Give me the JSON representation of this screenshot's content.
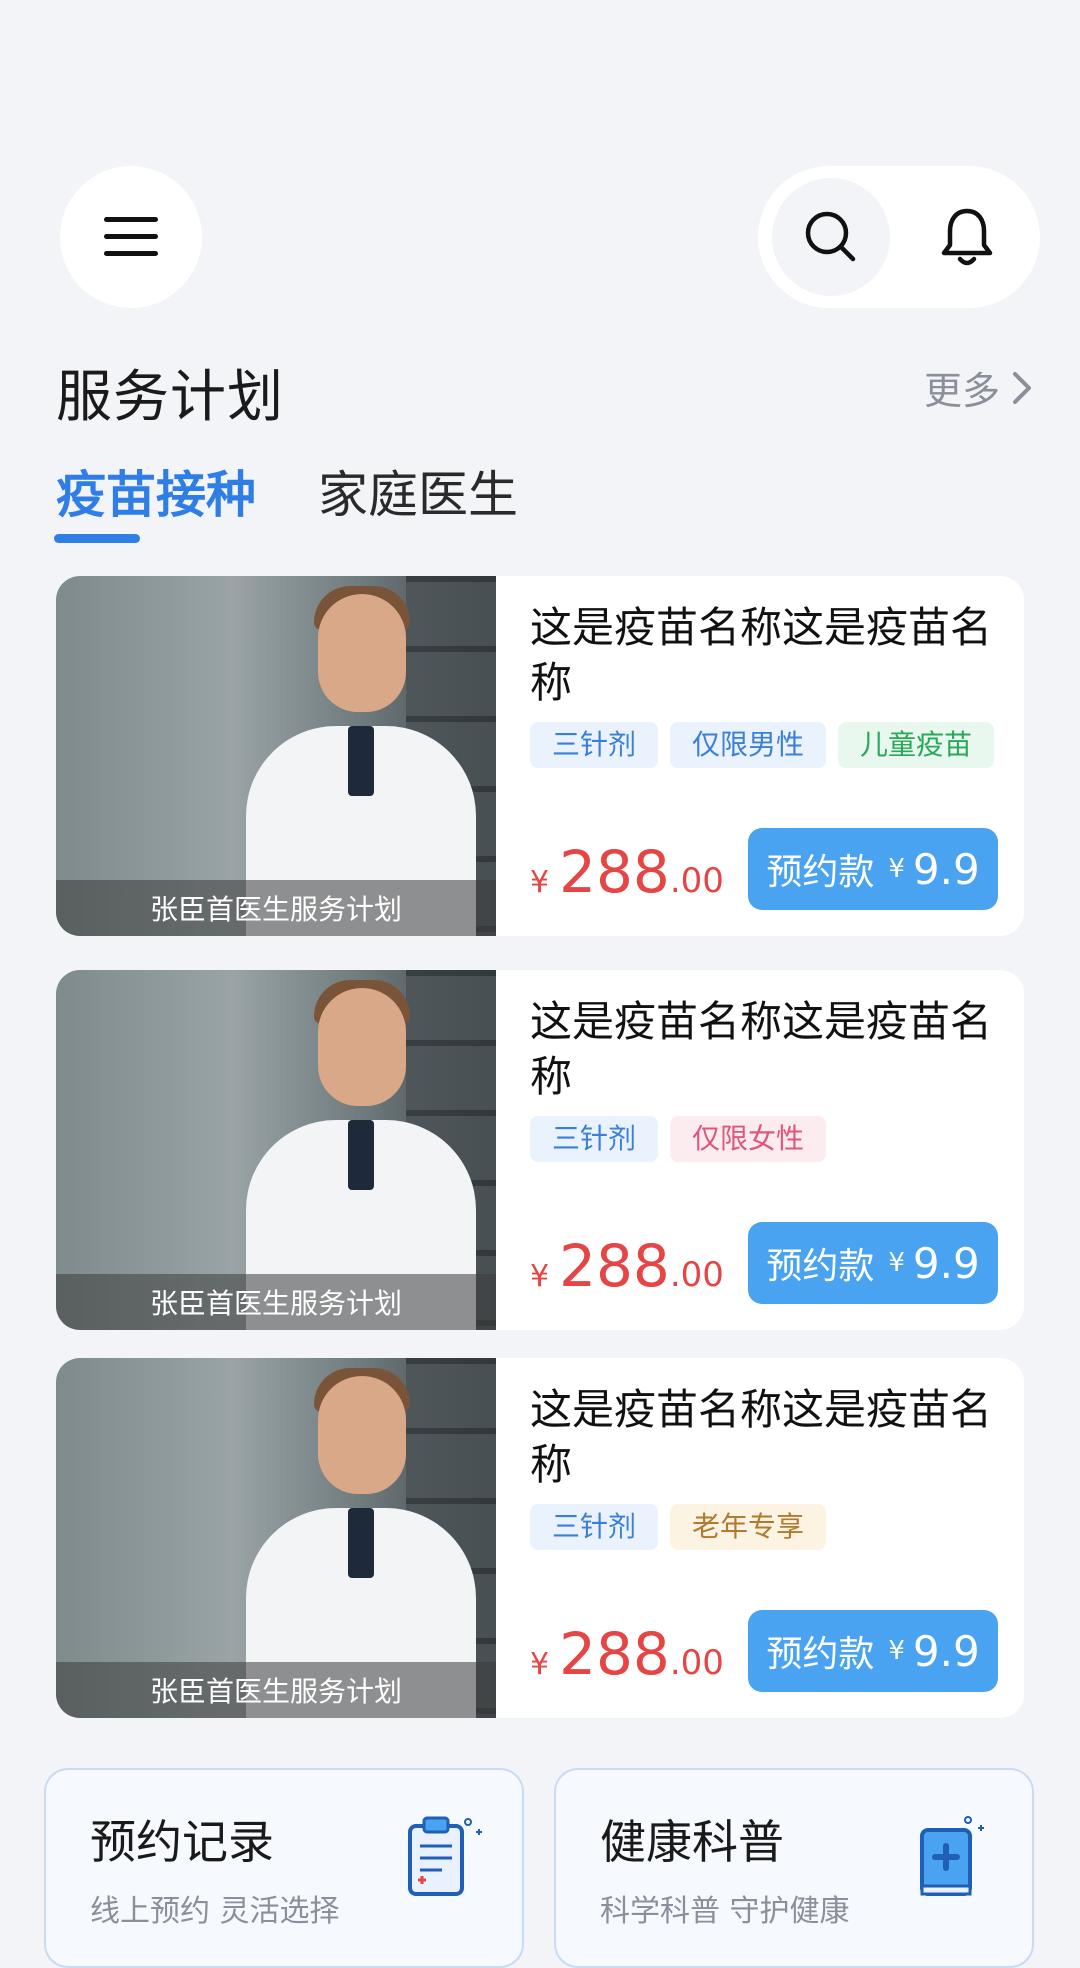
{
  "header": {
    "menu_icon": "menu-icon",
    "search_icon": "search-icon",
    "bell_icon": "bell-icon"
  },
  "section": {
    "title": "服务计划",
    "more": "更多"
  },
  "tabs": [
    {
      "label": "疫苗接种",
      "active": true
    },
    {
      "label": "家庭医生",
      "active": false
    }
  ],
  "cards": [
    {
      "image_caption": "张臣首医生服务计划",
      "name": "这是疫苗名称这是疫苗名称",
      "tags": [
        {
          "label": "三针剂",
          "color": "#3b7fd9"
        },
        {
          "label": "仅限男性",
          "color": "#3b7fd9"
        },
        {
          "label": "儿童疫苗",
          "color": "#2aa75a"
        }
      ],
      "price": {
        "currency": "¥",
        "integer": "288",
        "decimal": ".00"
      },
      "button": {
        "label": "预约款",
        "currency": "¥",
        "amount": "9.9"
      }
    },
    {
      "image_caption": "张臣首医生服务计划",
      "name": "这是疫苗名称这是疫苗名称",
      "tags": [
        {
          "label": "三针剂",
          "color": "#3b7fd9"
        },
        {
          "label": "仅限女性",
          "color": "#e0567a"
        }
      ],
      "price": {
        "currency": "¥",
        "integer": "288",
        "decimal": ".00"
      },
      "button": {
        "label": "预约款",
        "currency": "¥",
        "amount": "9.9"
      }
    },
    {
      "image_caption": "张臣首医生服务计划",
      "name": "这是疫苗名称这是疫苗名称",
      "tags": [
        {
          "label": "三针剂",
          "color": "#3b7fd9"
        },
        {
          "label": "老年专享",
          "color": "#b07a2f"
        }
      ],
      "price": {
        "currency": "¥",
        "integer": "288",
        "decimal": ".00"
      },
      "button": {
        "label": "预约款",
        "currency": "¥",
        "amount": "9.9"
      }
    }
  ],
  "bottom": [
    {
      "title": "预约记录",
      "subtitle": "线上预约 灵活选择",
      "icon": "clipboard-icon"
    },
    {
      "title": "健康科普",
      "subtitle": "科学科普 守护健康",
      "icon": "medical-book-icon"
    }
  ],
  "colors": {
    "accent": "#2f7ee6",
    "price": "#e64545",
    "button": "#4aa3f0",
    "background": "#f3f4f8"
  }
}
